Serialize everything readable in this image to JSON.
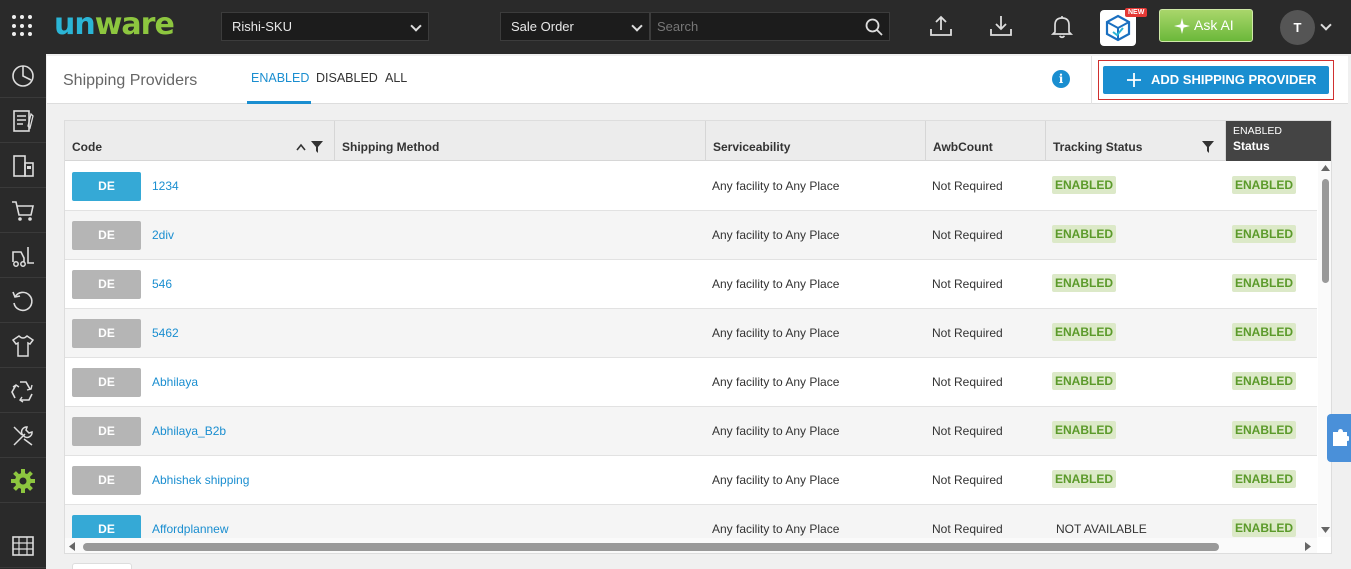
{
  "topbar": {
    "logo_part1": "un",
    "logo_part2": "ware",
    "facility_select": "Rishi-SKU",
    "search_type_select": "Sale Order",
    "search_placeholder": "Search",
    "new_badge": "NEW",
    "ask_ai_label": "Ask AI",
    "avatar_initial": "T"
  },
  "header": {
    "title": "Shipping Providers",
    "tabs": [
      {
        "label": "ENABLED",
        "active": true
      },
      {
        "label": "DISABLED",
        "active": false
      },
      {
        "label": "ALL",
        "active": false
      }
    ],
    "info_icon_glyph": "i",
    "add_button_label": "ADD SHIPPING PROVIDER"
  },
  "table": {
    "columns": {
      "code": "Code",
      "shipping_method": "Shipping Method",
      "serviceability": "Serviceability",
      "awb_count": "AwbCount",
      "tracking_status": "Tracking Status",
      "status_filter_value": "ENABLED",
      "status": "Status"
    },
    "rows": [
      {
        "badge": "DE",
        "badge_color": "#35a9d6",
        "code": "1234",
        "serviceability": "Any facility to Any Place",
        "awb_count": "Not Required",
        "tracking_status": "ENABLED",
        "tracking_pill": true,
        "status": "ENABLED"
      },
      {
        "badge": "DE",
        "badge_color": "#b5b5b5",
        "code": "2div",
        "serviceability": "Any facility to Any Place",
        "awb_count": "Not Required",
        "tracking_status": "ENABLED",
        "tracking_pill": true,
        "status": "ENABLED"
      },
      {
        "badge": "DE",
        "badge_color": "#b5b5b5",
        "code": "546",
        "serviceability": "Any facility to Any Place",
        "awb_count": "Not Required",
        "tracking_status": "ENABLED",
        "tracking_pill": true,
        "status": "ENABLED"
      },
      {
        "badge": "DE",
        "badge_color": "#b5b5b5",
        "code": "5462",
        "serviceability": "Any facility to Any Place",
        "awb_count": "Not Required",
        "tracking_status": "ENABLED",
        "tracking_pill": true,
        "status": "ENABLED"
      },
      {
        "badge": "DE",
        "badge_color": "#b5b5b5",
        "code": "Abhilaya",
        "serviceability": "Any facility to Any Place",
        "awb_count": "Not Required",
        "tracking_status": "ENABLED",
        "tracking_pill": true,
        "status": "ENABLED"
      },
      {
        "badge": "DE",
        "badge_color": "#b5b5b5",
        "code": "Abhilaya_B2b",
        "serviceability": "Any facility to Any Place",
        "awb_count": "Not Required",
        "tracking_status": "ENABLED",
        "tracking_pill": true,
        "status": "ENABLED"
      },
      {
        "badge": "DE",
        "badge_color": "#b5b5b5",
        "code": "Abhishek shipping",
        "serviceability": "Any facility to Any Place",
        "awb_count": "Not Required",
        "tracking_status": "ENABLED",
        "tracking_pill": true,
        "status": "ENABLED"
      },
      {
        "badge": "DE",
        "badge_color": "#35a9d6",
        "code": "Affordplannew",
        "serviceability": "Any facility to Any Place",
        "awb_count": "Not Required",
        "tracking_status": "NOT AVAILABLE",
        "tracking_pill": false,
        "status": "ENABLED"
      }
    ]
  },
  "colors": {
    "accent": "#1a8ed0",
    "topbar": "#2a2a2a",
    "pill_bg": "#dce9c8",
    "pill_text": "#5b9a2a",
    "settings_active": "#8dc63f"
  },
  "sidebar_icons": [
    "dashboard-icon",
    "orders-icon",
    "inventory-icon",
    "cart-icon",
    "forklift-icon",
    "returns-icon",
    "shirt-icon",
    "recycle-icon",
    "tools-icon",
    "settings-icon",
    "warehouse-icon"
  ]
}
